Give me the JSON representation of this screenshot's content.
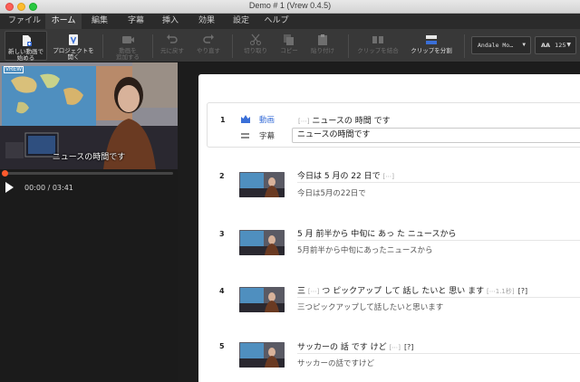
{
  "window": {
    "title": "Demo # 1 (Vrew 0.4.5)"
  },
  "menu": {
    "tabs": [
      "ファイル",
      "ホーム",
      "編集",
      "字幕",
      "挿入",
      "効果",
      "設定",
      "ヘルプ"
    ],
    "active_index": 1
  },
  "toolbar": {
    "new_video": "新しい動画で\n始める",
    "open_project": "プロジェクトを\n開く",
    "add_video": "動画を\n追加する",
    "undo": "元に戻す",
    "redo": "やり直す",
    "cut": "切り取り",
    "copy": "コピー",
    "paste": "貼り付け",
    "merge_clips": "クリップを結合",
    "split_clip": "クリップを分割",
    "font_name": "Andale Mo…",
    "font_size_icon": "AA",
    "font_size": "125"
  },
  "player": {
    "badge": "VREW",
    "caption": "ニュースの時間です",
    "time": "00:00 / 03:41",
    "progress": 0.0
  },
  "clips": [
    {
      "num": "1",
      "video_label": "動画",
      "subtitle_label": "字幕",
      "words_mute": "[⋯]",
      "words": "ニュースの 時間 です",
      "subtitle": "ニュースの時間です"
    },
    {
      "num": "2",
      "words": "今日は 5 月の 22 日で",
      "words_mute": "[⋯]",
      "subtitle": "今日は5月の22日で"
    },
    {
      "num": "3",
      "words": "5 月 前半から 中旬に あっ た ニュースから",
      "subtitle": "5月前半から中旬にあったニュースから"
    },
    {
      "num": "4",
      "words_a": "三",
      "words_mute_a": "[⋯]",
      "words_b": "つ ピックアップ して 話し たいと 思い ます",
      "words_mute_b": "[⋯1.1秒]",
      "words_q": "[?]",
      "subtitle": "三つピックアップして話したいと思います"
    },
    {
      "num": "5",
      "words": "サッカーの 話 です けど",
      "words_mute": "[⋯]",
      "words_q": "[?]",
      "subtitle": "サッカーの話ですけど"
    }
  ],
  "colors": {
    "accent_blue": "#3a6fd8",
    "seek_knob": "#ff5a2c"
  },
  "icons": [
    "new-video-icon",
    "open-project-icon",
    "add-video-icon",
    "undo-icon",
    "redo-icon",
    "scissors-icon",
    "copy-icon",
    "paste-icon",
    "merge-icon",
    "split-icon",
    "play-icon",
    "crown-video-icon",
    "subtitle-lines-icon"
  ]
}
